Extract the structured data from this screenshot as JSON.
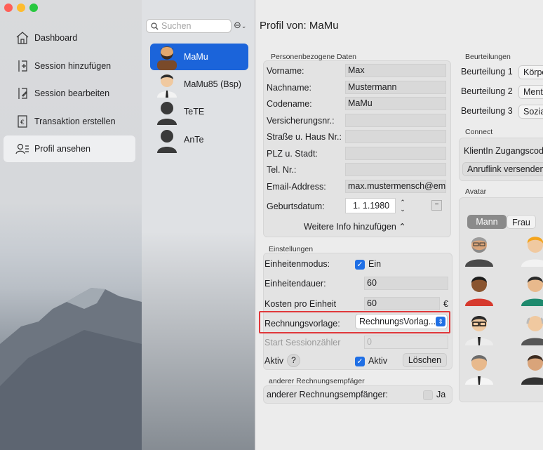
{
  "window": {
    "traffic_lights": [
      "#ff5f57",
      "#febc2e",
      "#28c840"
    ]
  },
  "sidebar": {
    "items": [
      {
        "label": "Dashboard",
        "icon": "house-icon"
      },
      {
        "label": "Session hinzufügen",
        "icon": "session-add-icon"
      },
      {
        "label": "Session bearbeiten",
        "icon": "session-edit-icon"
      },
      {
        "label": "Transaktion erstellen",
        "icon": "transaction-icon"
      },
      {
        "label": "Profil ansehen",
        "icon": "profile-icon",
        "selected": true
      }
    ]
  },
  "search": {
    "placeholder": "Suchen"
  },
  "clients": [
    {
      "name": "MaMu",
      "selected": true
    },
    {
      "name": "MaMu85 (Bsp)"
    },
    {
      "name": "TeTE"
    },
    {
      "name": "AnTe"
    }
  ],
  "main": {
    "title": "Profil von: MaMu",
    "personal": {
      "group_label": "Personenbezogene Daten",
      "fields": [
        {
          "label": "Vorname:",
          "value": "Max"
        },
        {
          "label": "Nachname:",
          "value": "Mustermann"
        },
        {
          "label": "Codename:",
          "value": "MaMu"
        },
        {
          "label": "Versicherungsnr.:",
          "value": ""
        },
        {
          "label": "Straße u. Haus Nr.:",
          "value": ""
        },
        {
          "label": "PLZ u. Stadt:",
          "value": ""
        },
        {
          "label": "Tel. Nr.:",
          "value": ""
        },
        {
          "label": "Email-Address:",
          "value": "max.mustermensch@em"
        }
      ],
      "birthdate_label": "Geburtsdatum:",
      "birthdate_value": "1. 1.1980",
      "more_info": "Weitere Info hinzufügen ⌃"
    },
    "settings": {
      "group_label": "Einstellungen",
      "einheitenmodus_label": "Einheitenmodus:",
      "einheitenmodus_value": "Ein",
      "einheitendauer_label": "Einheitendauer:",
      "einheitendauer_value": "60",
      "kosten_label": "Kosten pro Einheit",
      "kosten_value": "60",
      "currency": "€",
      "rechnungsvorlage_label": "Rechnungsvorlage:",
      "rechnungsvorlage_value": "RechnungsVorlag...",
      "sessionzaehler_label": "Start Sessionzähler",
      "sessionzaehler_value": "0",
      "aktiv_label": "Aktiv",
      "help": "?",
      "aktiv_check_label": "Aktiv",
      "delete_label": "Löschen"
    },
    "other_recipient": {
      "group_label": "anderer Rechnungsempfäger",
      "label": "anderer Rechnungsempfänger:",
      "value": "Ja"
    },
    "ratings": {
      "group_label": "Beurteilungen",
      "rows": [
        {
          "label": "Beurteilung 1",
          "value": "Körpe"
        },
        {
          "label": "Beurteilung 2",
          "value": "Menta"
        },
        {
          "label": "Beurteilung 3",
          "value": "Sozia"
        }
      ]
    },
    "connect": {
      "group_label": "Connect",
      "code_label": "KlientIn Zugangscod",
      "call_button": "Anruflink versenden"
    },
    "avatar": {
      "group_label": "Avatar",
      "tabs": [
        "Mann",
        "Frau"
      ]
    }
  }
}
